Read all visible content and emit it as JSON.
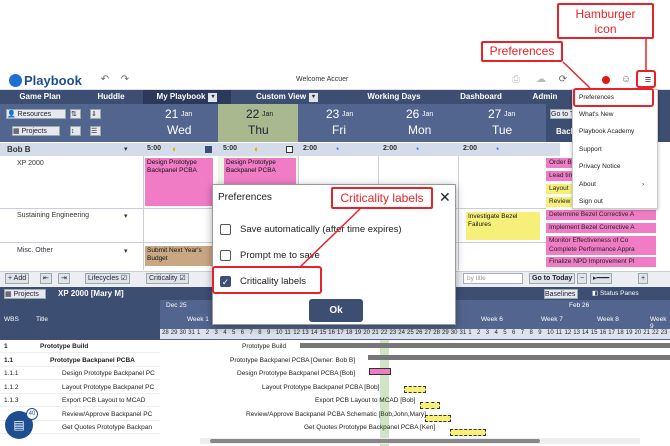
{
  "callouts": {
    "hamburger": "Hamburger\nicon",
    "preferences": "Preferences",
    "criticality": "Criticality labels"
  },
  "app": {
    "name": "Playbook",
    "welcome": "Welcome Accuer"
  },
  "nav": {
    "tabs": [
      "Game Plan",
      "Huddle",
      "My Playbook",
      "Custom View",
      "Working Days",
      "Dashboard",
      "Admin"
    ]
  },
  "toolbar": {
    "resources": "Resources",
    "projects": "Projects"
  },
  "days": [
    {
      "num": "21",
      "mon": "Jan",
      "name": "Wed"
    },
    {
      "num": "22",
      "mon": "Jan",
      "name": "Thu"
    },
    {
      "num": "23",
      "mon": "Jan",
      "name": "Fri"
    },
    {
      "num": "26",
      "mon": "Jan",
      "name": "Mon"
    },
    {
      "num": "27",
      "mon": "Jan",
      "name": "Tue"
    }
  ],
  "person": {
    "name": "Bob B",
    "hours": [
      "5:00",
      "5:00",
      "2:00",
      "2:00",
      "2:00"
    ]
  },
  "rows": {
    "xp": "XP 2000",
    "sustaining": "Sustaining Engineering",
    "misc": "Misc. Other"
  },
  "tasks": {
    "t1": "Design Prototype Backpanel PCBA",
    "t2": "Design Prototype Backpanel PCBA",
    "t3": "Investigate Bezel Failures",
    "t4": "Submit Next Year's Budget"
  },
  "side": {
    "goto": "Go to T",
    "back": "Back",
    "items": [
      "Order B",
      "Lead tin",
      "Layout",
      "Review",
      "Determine Bezel Corrective A",
      "Implement Bezel Corrective A",
      "Monitor Effectiveness of Co",
      "Complete Performance Appra",
      "Finalize NPD Improvement Pl"
    ]
  },
  "menu": {
    "items": [
      "Preferences",
      "What's New",
      "Playbook Academy",
      "Support",
      "Privacy Notice",
      "About",
      "Sign out"
    ]
  },
  "modal": {
    "title": "Preferences",
    "opt1": "Save automatically (after time expires)",
    "opt2": "Prompt me to save",
    "opt3": "Criticality labels",
    "ok": "Ok",
    "opt1_checked": false,
    "opt2_checked": false,
    "opt3_checked": true
  },
  "gantt": {
    "add": "+ Add",
    "lifecycles": "Lifecycles",
    "criticality": "Criticality",
    "search_placeholder": "by title",
    "goto": "Go to Today",
    "projects": "Projects",
    "project": "XP 2000 [Mary M]",
    "baselines": "Baselines",
    "status": "Status Panes",
    "col_wbs": "WBS",
    "col_title": "Title",
    "months": [
      "Dec 25",
      "Feb 26"
    ],
    "weeks": [
      "Week 1",
      "Week 6",
      "Week 7",
      "Week 8",
      "Week 9"
    ],
    "daynums": [
      "28",
      "29",
      "30",
      "31",
      "1",
      "2",
      "3",
      "4",
      "5",
      "6",
      "7",
      "8",
      "9",
      "10",
      "11",
      "12",
      "13",
      "14",
      "15",
      "16",
      "17",
      "18",
      "19",
      "20",
      "21",
      "22",
      "23",
      "24",
      "25",
      "26",
      "27",
      "28",
      "29",
      "30",
      "31",
      "1",
      "2",
      "3",
      "4",
      "5",
      "6",
      "7",
      "8",
      "9",
      "10",
      "11",
      "12",
      "13",
      "14",
      "15",
      "16",
      "17",
      "18",
      "19",
      "20",
      "21",
      "22",
      "23"
    ],
    "rows": [
      {
        "wbs": "1",
        "title": "Prototype Build",
        "bar": "Prototype Build"
      },
      {
        "wbs": "1.1",
        "title": "Prototype Backpanel PCBA",
        "bar": "Prototype Backpanel PCBA [Owner: Bob B]"
      },
      {
        "wbs": "1.1.1",
        "title": "Design Prototype Backpanel PC",
        "bar": "Design Prototype Backpanel PCBA [Bob]"
      },
      {
        "wbs": "1.1.2",
        "title": "Layout Prototype Backpanel PC",
        "bar": "Layout Prototype Backpanel PCBA [Bob]"
      },
      {
        "wbs": "1.1.3",
        "title": "Export PCB Layout to MCAD",
        "bar": "Export PCB Layout to MCAD [Bob]"
      },
      {
        "wbs": "",
        "title": "Review/Approve Backpanel PC",
        "bar": "Review/Approve Backpanel PCBA Schematic [Bob,John,Mary]"
      },
      {
        "wbs": "",
        "title": "Get Quotes Prototype Backpan",
        "bar": "Get Quotes Prototype Backpanel PCBA [Ken]"
      }
    ],
    "badge": "40"
  },
  "colors": {
    "nav": "#3d4e73",
    "accent": "#e8222a",
    "today": "#a8b98f",
    "pink": "#f07cc6",
    "yellow": "#f6f07a"
  }
}
